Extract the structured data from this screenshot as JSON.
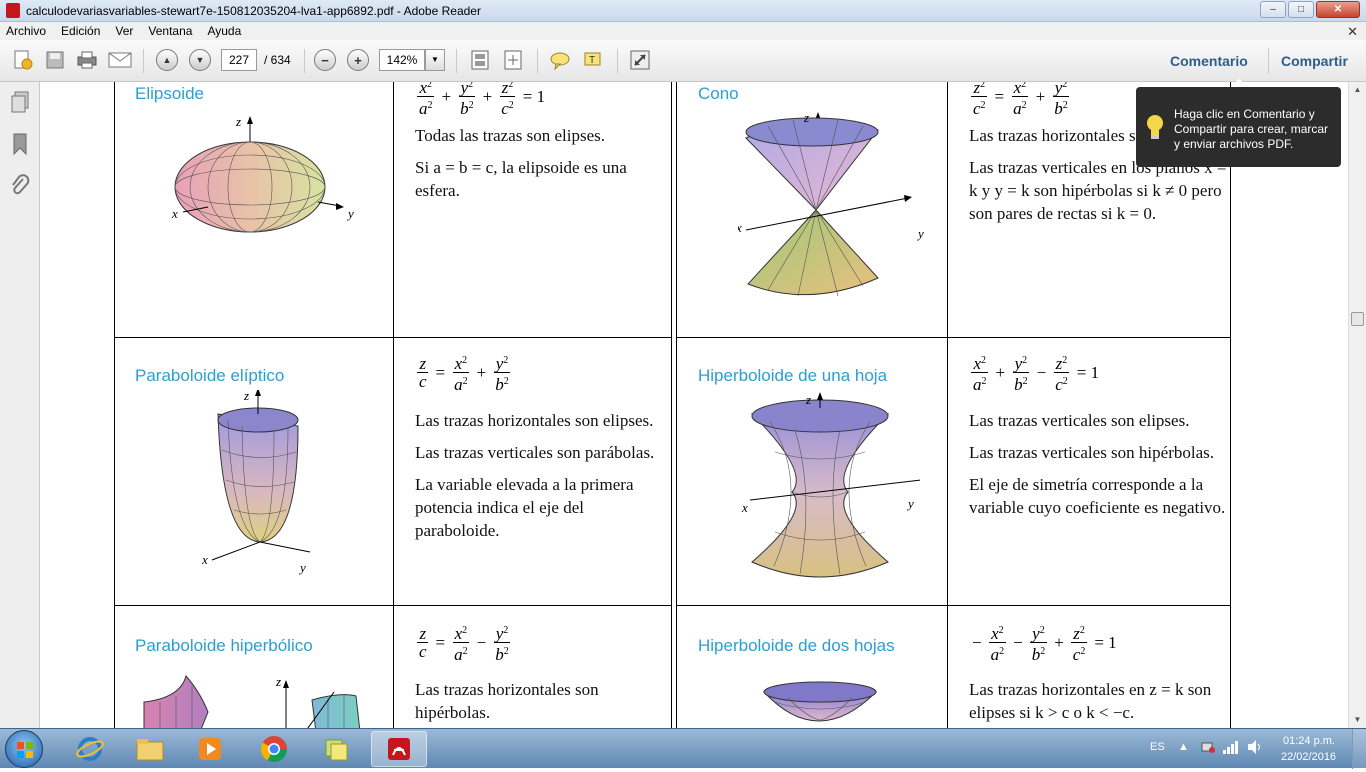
{
  "window": {
    "title": "calculodevariasvariables-stewart7e-150812035204-lva1-app6892.pdf - Adobe Reader",
    "controls": {
      "minimize": "–",
      "maximize": "□",
      "close": "✕"
    }
  },
  "menu": {
    "items": [
      "Archivo",
      "Edición",
      "Ver",
      "Ventana",
      "Ayuda"
    ],
    "close_glyph": "✕"
  },
  "toolbar": {
    "page_current": "227",
    "page_total": "/ 634",
    "zoom": "142%",
    "comment_label": "Comentario",
    "share_label": "Compartir",
    "prev_glyph": "▲",
    "next_glyph": "▼",
    "zoom_out_glyph": "−",
    "zoom_in_glyph": "+",
    "dropdown_glyph": "▼"
  },
  "tooltip": {
    "text": "Haga clic en Comentario y Compartir para crear, marcar y enviar archivos PDF."
  },
  "surfaces": [
    {
      "name": "Elipsoide",
      "formula_vars": [
        "x",
        "a",
        "y",
        "b",
        "z",
        "c"
      ],
      "formula_rhs": "= 1",
      "description": [
        "Todas las trazas son elipses.",
        "Si a = b = c, la elipsoide es una esfera."
      ]
    },
    {
      "name": "Cono",
      "formula_vars": [
        "z",
        "c",
        "x",
        "a",
        "y",
        "b"
      ],
      "description": [
        "Las trazas horizontales son elipses.",
        "Las trazas verticales en los planos x = k y y = k son hipérbolas si k ≠ 0 pero son pares de rectas si k = 0."
      ]
    },
    {
      "name": "Paraboloide elíptico",
      "formula_vars": [
        "z",
        "c",
        "x",
        "a",
        "y",
        "b"
      ],
      "description": [
        "Las trazas horizontales son elipses.",
        "Las trazas verticales son parábolas.",
        "La variable elevada a la primera potencia indica el eje del paraboloide."
      ]
    },
    {
      "name": "Hiperboloide de una hoja",
      "formula_vars": [
        "x",
        "a",
        "y",
        "b",
        "z",
        "c"
      ],
      "formula_rhs": "= 1",
      "description": [
        "Las trazas verticales son elipses.",
        "Las trazas verticales son hipérbolas.",
        "El eje de simetría corresponde a la variable cuyo coeficiente es negativo."
      ]
    },
    {
      "name": "Paraboloide hiperbólico",
      "formula_vars": [
        "z",
        "c",
        "x",
        "a",
        "y",
        "b"
      ],
      "description": [
        "Las trazas horizontales son hipérbolas."
      ]
    },
    {
      "name": "Hiperboloide de dos hojas",
      "formula_vars": [
        "x",
        "a",
        "y",
        "b",
        "z",
        "c"
      ],
      "formula_rhs": "= 1",
      "description": [
        "Las trazas horizontales en z = k son elipses si k > c o k < −c."
      ]
    }
  ],
  "axis_labels": {
    "x": "x",
    "y": "y",
    "z": "z"
  },
  "taskbar": {
    "language": "ES",
    "time": "01:24 p.m.",
    "date": "22/02/2016"
  }
}
